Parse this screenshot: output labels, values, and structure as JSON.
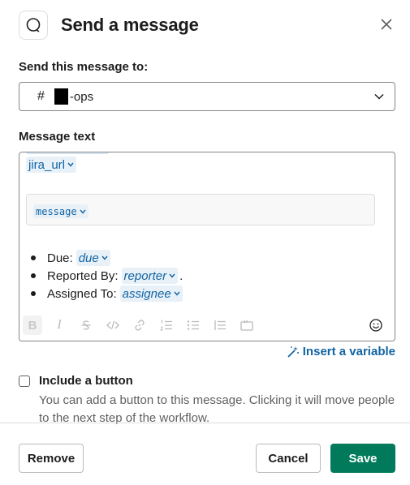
{
  "dialog": {
    "title": "Send a message",
    "icons": {
      "app": "search-bubble-icon",
      "close": "close-icon"
    }
  },
  "recipient": {
    "label": "Send this message to:",
    "hash": "#",
    "channel_suffix": "-ops",
    "icon": "chevron-down-icon"
  },
  "message": {
    "label": "Message text",
    "tokens": {
      "jira_url": "jira_url",
      "message": "message",
      "due": "due",
      "reporter": "reporter",
      "assignee": "assignee"
    },
    "bullets": {
      "due_label": "Due:",
      "reported_label": "Reported By:",
      "reported_suffix": ".",
      "assigned_label": "Assigned To:"
    },
    "toolbar": [
      "bold",
      "italic",
      "strikethrough",
      "code",
      "link",
      "ordered-list",
      "bulleted-list",
      "indent",
      "code-block",
      "emoji"
    ]
  },
  "insert_variable": {
    "label": "Insert a variable",
    "icon": "magic-wand-icon"
  },
  "button_option": {
    "label": "Include a button",
    "checked": false,
    "help": "You can add a button to this message. Clicking it will move people to the next step of the workflow."
  },
  "footer": {
    "remove_label": "Remove",
    "cancel_label": "Cancel",
    "save_label": "Save",
    "save_color": "#007a5a",
    "link_color": "#1264a3"
  }
}
